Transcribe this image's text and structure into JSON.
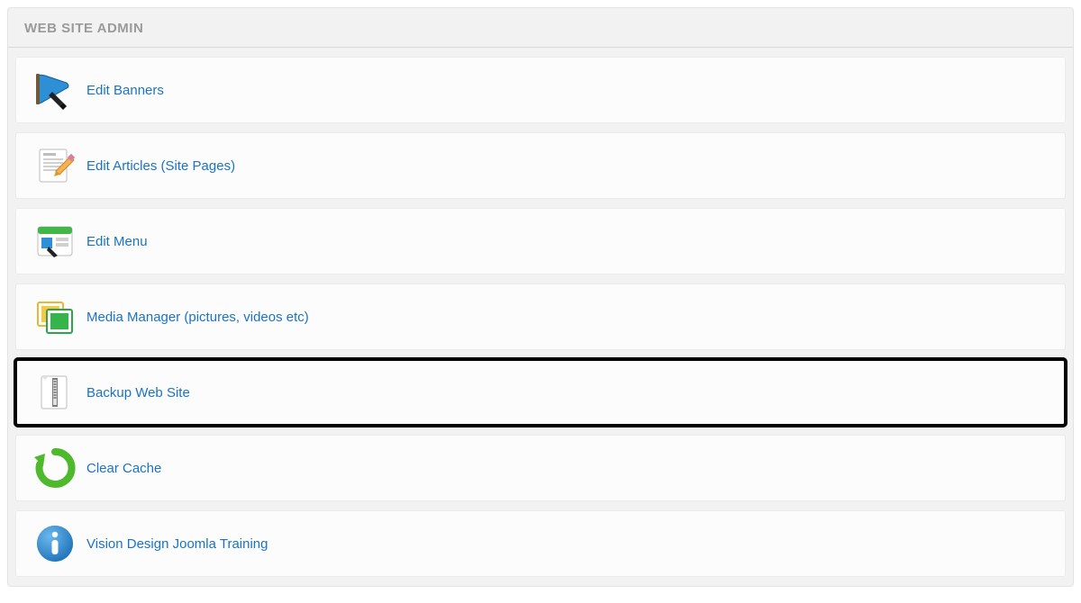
{
  "panel": {
    "title": "WEB SITE ADMIN",
    "items": [
      {
        "label": "Edit Banners",
        "icon": "banner",
        "highlighted": false
      },
      {
        "label": "Edit Articles (Site Pages)",
        "icon": "article",
        "highlighted": false
      },
      {
        "label": "Edit Menu",
        "icon": "menu",
        "highlighted": false
      },
      {
        "label": "Media Manager (pictures, videos etc)",
        "icon": "media",
        "highlighted": false
      },
      {
        "label": "Backup Web Site",
        "icon": "backup",
        "highlighted": true
      },
      {
        "label": "Clear Cache",
        "icon": "refresh",
        "highlighted": false
      },
      {
        "label": "Vision Design Joomla Training",
        "icon": "info",
        "highlighted": false
      }
    ]
  }
}
